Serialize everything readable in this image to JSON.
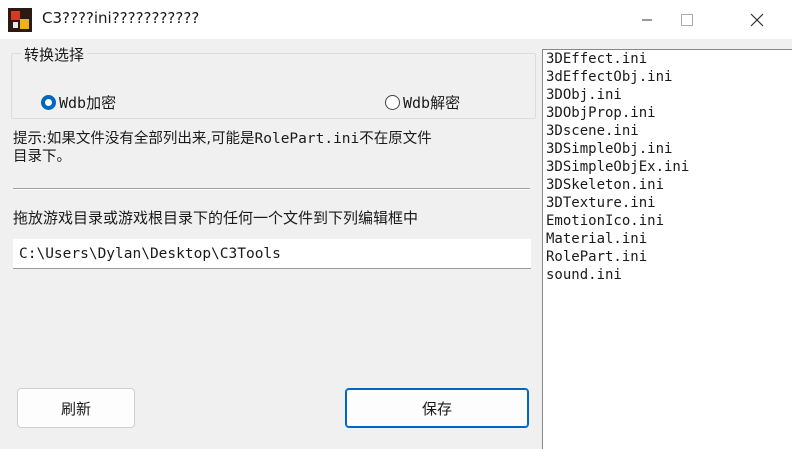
{
  "window": {
    "title": "C3????ini???????????",
    "icon": "app-icon",
    "controls": [
      "minimize-icon",
      "maximize-icon",
      "close-icon"
    ]
  },
  "mode_group": {
    "legend": "转换选择",
    "options": [
      {
        "prefix": "Wdb",
        "label": "加密",
        "checked": true
      },
      {
        "prefix": "Wdb",
        "label": "解密",
        "checked": false
      }
    ]
  },
  "hint": {
    "text_line1": "提示:如果文件没有全部列出来,可能是",
    "mono_part": "RolePart.ini",
    "text_line1_end": "不在原文件",
    "text_line2": "目录下。"
  },
  "drop": {
    "label": "拖放游戏目录或游戏根目录下的任何一个文件到下列编辑框中",
    "path_value": "C:\\Users\\Dylan\\Desktop\\C3Tools"
  },
  "buttons": {
    "refresh": "刷新",
    "save": "保存"
  },
  "file_list": [
    "3DEffect.ini",
    "3dEffectObj.ini",
    "3DObj.ini",
    "3DObjProp.ini",
    "3Dscene.ini",
    "3DSimpleObj.ini",
    "3DSimpleObjEx.ini",
    "3DSkeleton.ini",
    "3DTexture.ini",
    "EmotionIco.ini",
    "Material.ini",
    "RolePart.ini",
    "sound.ini"
  ],
  "colors": {
    "accent": "#0067c0",
    "window_bg": "#f0f0f0",
    "titlebar_bg": "#ffffff"
  }
}
